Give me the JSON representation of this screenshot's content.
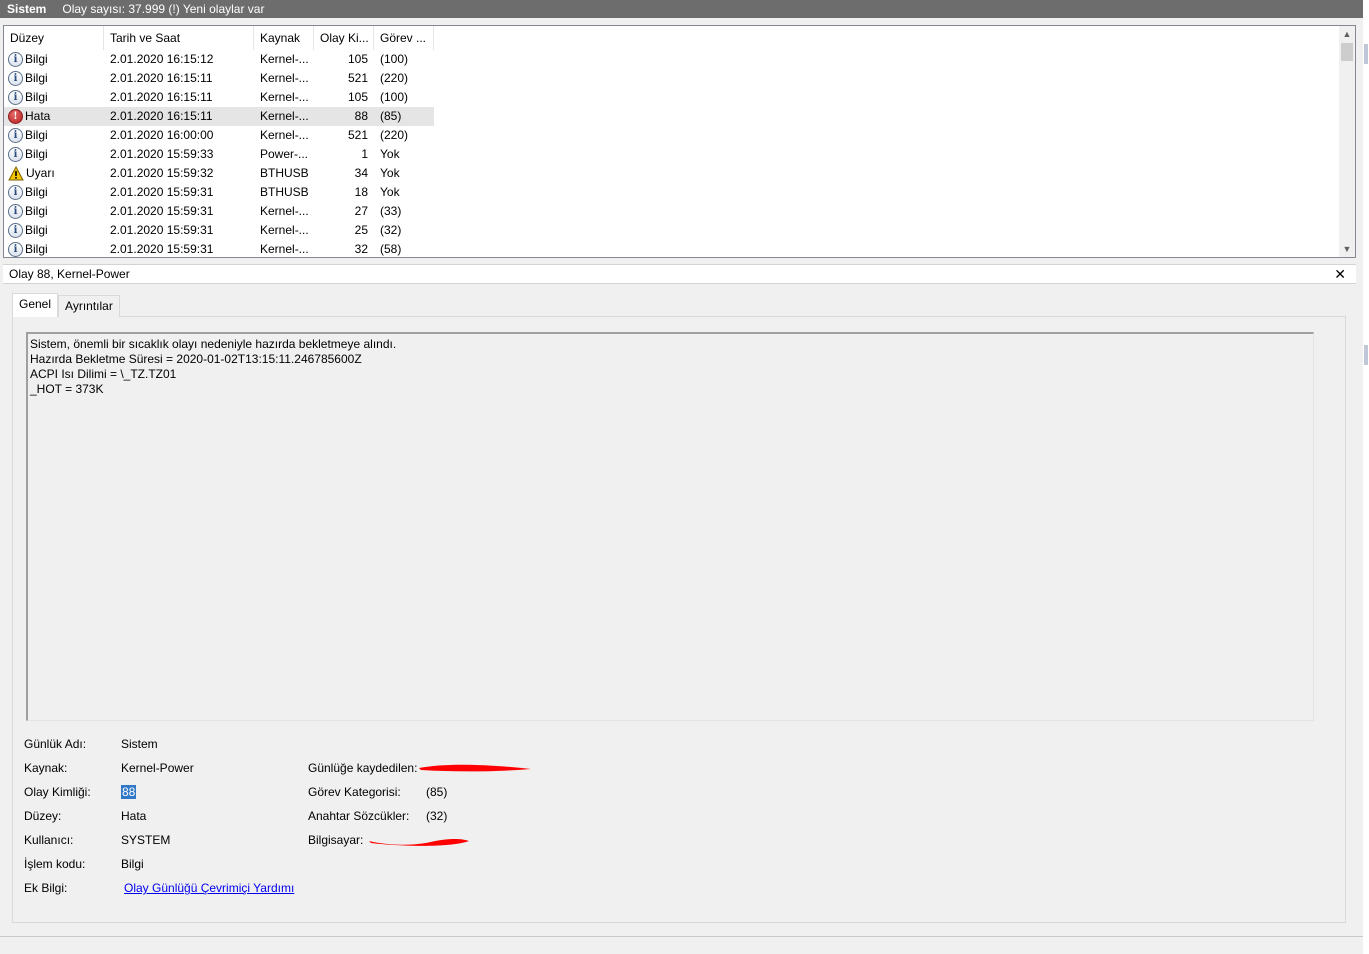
{
  "header": {
    "title": "Sistem",
    "status": "Olay sayısı: 37.999 (!) Yeni olaylar var"
  },
  "list": {
    "columns": [
      "Düzey",
      "Tarih ve Saat",
      "Kaynak",
      "Olay Ki...",
      "Görev ..."
    ],
    "rows": [
      {
        "level": "Bilgi",
        "icon": "info-icon",
        "date": "2.01.2020 16:15:12",
        "source": "Kernel-...",
        "id": "105",
        "task": "(100)"
      },
      {
        "level": "Bilgi",
        "icon": "info-icon",
        "date": "2.01.2020 16:15:11",
        "source": "Kernel-...",
        "id": "521",
        "task": "(220)"
      },
      {
        "level": "Bilgi",
        "icon": "info-icon",
        "date": "2.01.2020 16:15:11",
        "source": "Kernel-...",
        "id": "105",
        "task": "(100)"
      },
      {
        "level": "Hata",
        "icon": "error-icon",
        "date": "2.01.2020 16:15:11",
        "source": "Kernel-...",
        "id": "88",
        "task": "(85)",
        "selected": true
      },
      {
        "level": "Bilgi",
        "icon": "info-icon",
        "date": "2.01.2020 16:00:00",
        "source": "Kernel-...",
        "id": "521",
        "task": "(220)"
      },
      {
        "level": "Bilgi",
        "icon": "info-icon",
        "date": "2.01.2020 15:59:33",
        "source": "Power-...",
        "id": "1",
        "task": "Yok"
      },
      {
        "level": "Uyarı",
        "icon": "warning-icon",
        "date": "2.01.2020 15:59:32",
        "source": "BTHUSB",
        "id": "34",
        "task": "Yok"
      },
      {
        "level": "Bilgi",
        "icon": "info-icon",
        "date": "2.01.2020 15:59:31",
        "source": "BTHUSB",
        "id": "18",
        "task": "Yok"
      },
      {
        "level": "Bilgi",
        "icon": "info-icon",
        "date": "2.01.2020 15:59:31",
        "source": "Kernel-...",
        "id": "27",
        "task": "(33)"
      },
      {
        "level": "Bilgi",
        "icon": "info-icon",
        "date": "2.01.2020 15:59:31",
        "source": "Kernel-...",
        "id": "25",
        "task": "(32)"
      },
      {
        "level": "Bilgi",
        "icon": "info-icon",
        "date": "2.01.2020 15:59:31",
        "source": "Kernel-...",
        "id": "32",
        "task": "(58)"
      }
    ]
  },
  "detail": {
    "title": "Olay 88, Kernel-Power",
    "tabs": [
      "Genel",
      "Ayrıntılar"
    ],
    "description": [
      "Sistem, önemli bir sıcaklık olayı nedeniyle hazırda bekletmeye alındı.",
      "Hazırda Bekletme Süresi = 2020-01-02T13:15:11.246785600Z",
      "ACPI Isı Dilimi = \\_TZ.TZ01",
      "_HOT = 373K"
    ],
    "props": {
      "log_name_label": "Günlük Adı:",
      "log_name": "Sistem",
      "source_label": "Kaynak:",
      "source": "Kernel-Power",
      "event_id_label": "Olay Kimliği:",
      "event_id": "88",
      "level_label": "Düzey:",
      "level": "Hata",
      "user_label": "Kullanıcı:",
      "user": "SYSTEM",
      "opcode_label": "İşlem kodu:",
      "opcode": "Bilgi",
      "more_info_label": "Ek Bilgi:",
      "more_info_link": "Olay Günlüğü Çevrimiçi Yardımı",
      "logged_label": "Günlüğe kaydedilen:",
      "task_category_label": "Görev Kategorisi:",
      "task_category": "(85)",
      "keywords_label": "Anahtar Sözcükler:",
      "keywords": "(32)",
      "computer_label": "Bilgisayar:"
    }
  },
  "colors": {
    "header_bg": "#6d6d6d",
    "selection": "#3178c6",
    "link": "#0000ee",
    "redaction": "#ff0000"
  }
}
